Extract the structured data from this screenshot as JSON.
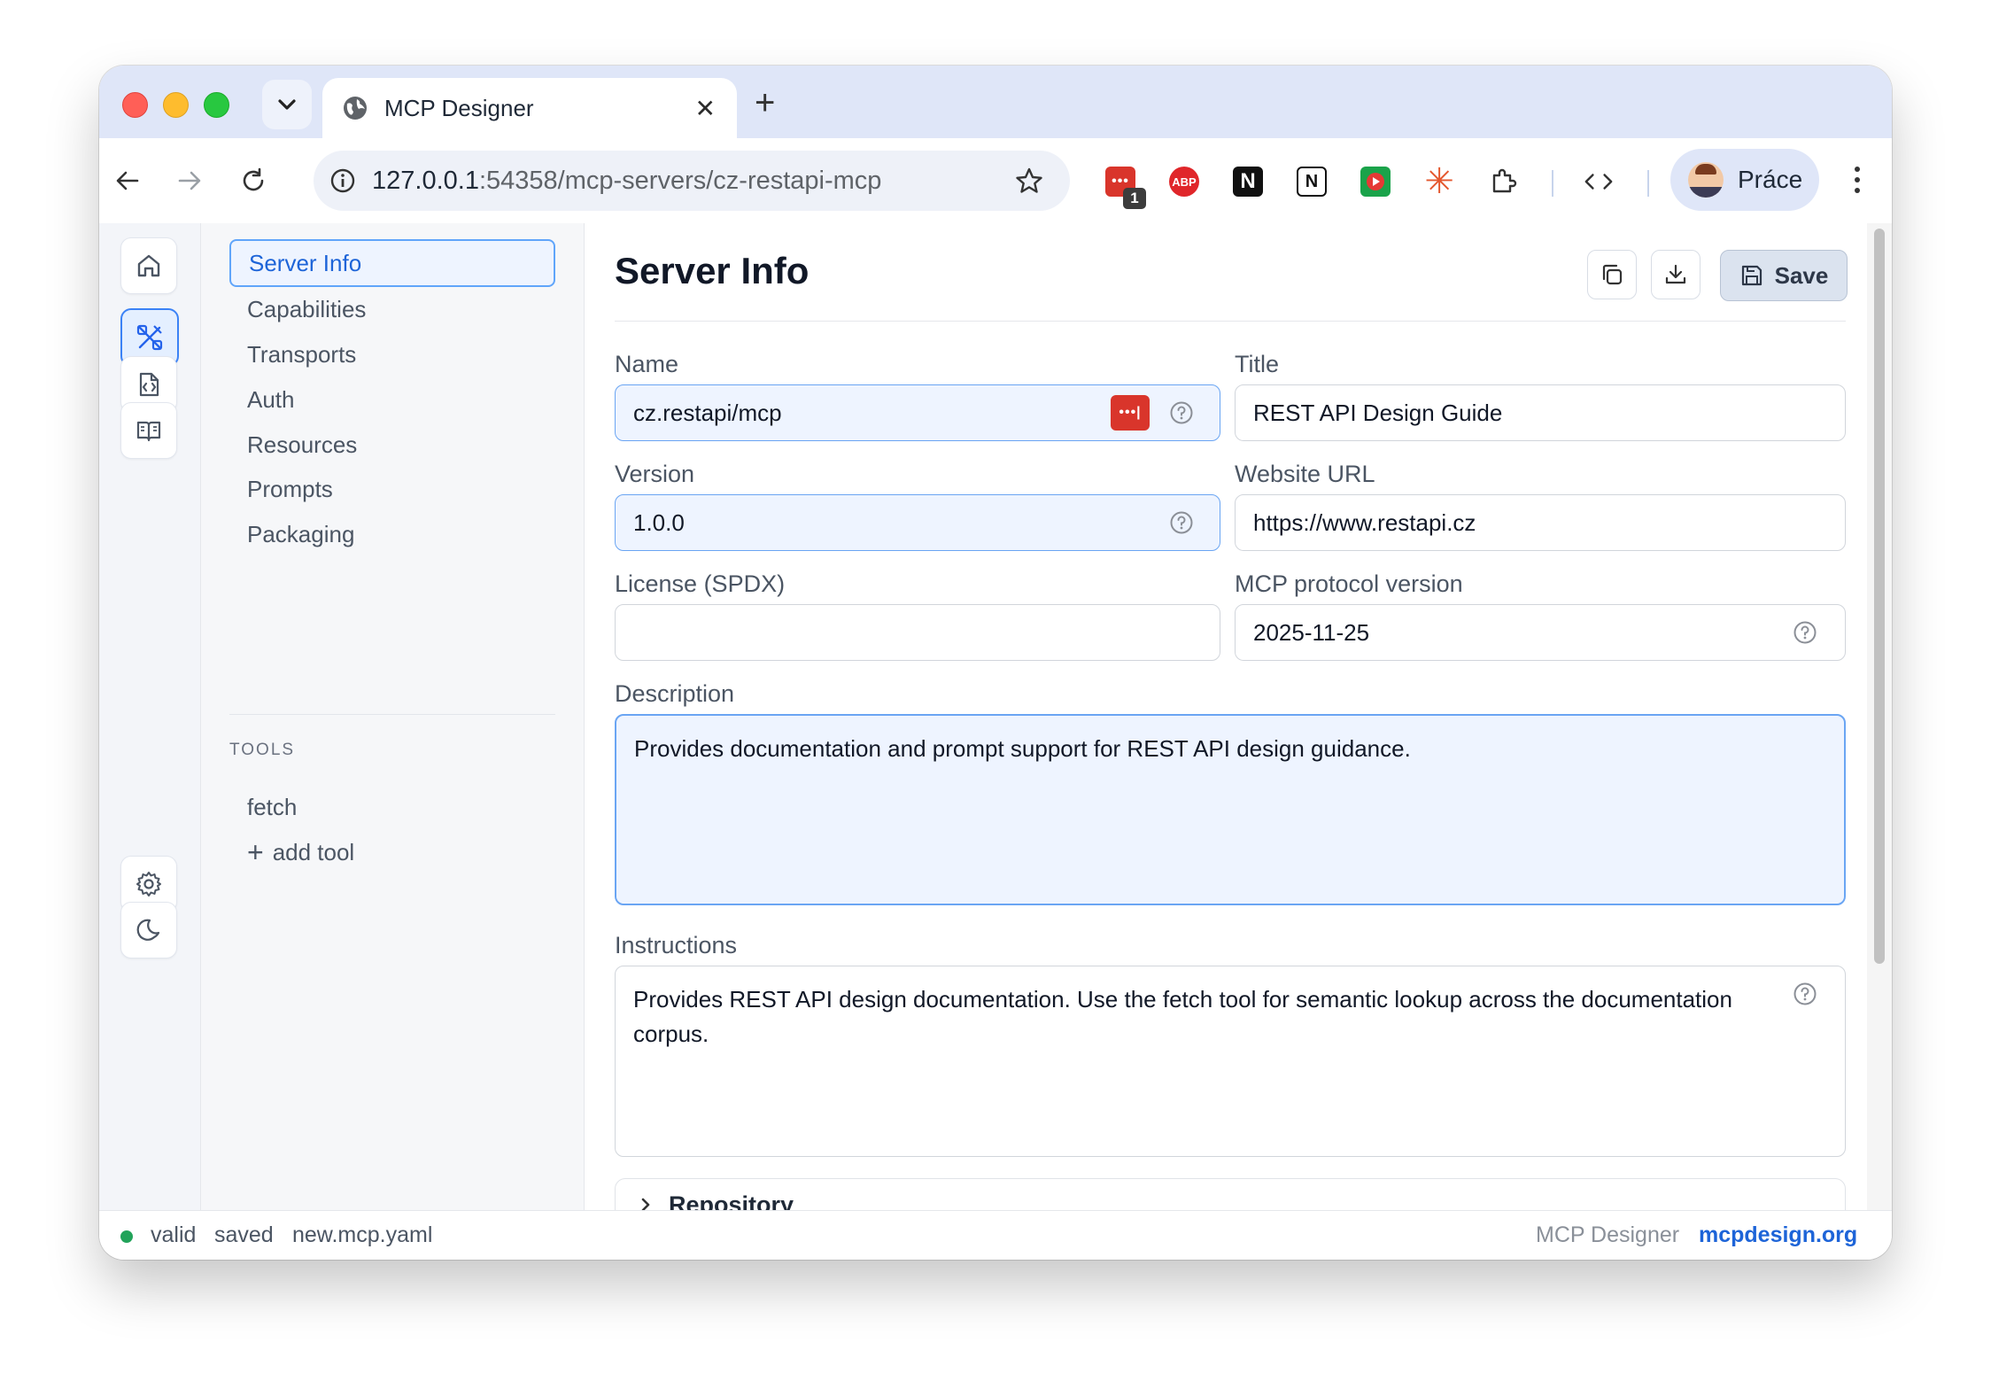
{
  "browser": {
    "tab_title": "MCP Designer",
    "url_host": "127.0.0.1",
    "url_path": ":54358/mcp-servers/cz-restapi-mcp",
    "profile_name": "Práce",
    "extension_badge": "1",
    "abp_label": "ABP",
    "notion_label": "N"
  },
  "sidebar": {
    "items": [
      {
        "label": "Server Info"
      },
      {
        "label": "Capabilities"
      },
      {
        "label": "Transports"
      },
      {
        "label": "Auth"
      },
      {
        "label": "Resources"
      },
      {
        "label": "Prompts"
      },
      {
        "label": "Packaging"
      }
    ],
    "tools_heading": "TOOLS",
    "tools": [
      {
        "label": "fetch"
      }
    ],
    "add_tool_label": "add tool"
  },
  "main": {
    "title": "Server Info",
    "save_label": "Save",
    "fields": {
      "name": {
        "label": "Name",
        "value": "cz.restapi/mcp"
      },
      "title": {
        "label": "Title",
        "value": "REST API Design Guide"
      },
      "version": {
        "label": "Version",
        "value": "1.0.0"
      },
      "website": {
        "label": "Website URL",
        "value": "https://www.restapi.cz"
      },
      "license": {
        "label": "License (SPDX)",
        "value": ""
      },
      "protocol": {
        "label": "MCP protocol version",
        "value": "2025-11-25"
      },
      "description": {
        "label": "Description",
        "value": "Provides documentation and prompt support for REST API design guidance."
      },
      "instructions": {
        "label": "Instructions",
        "value": "Provides REST API design documentation. Use the fetch tool for semantic lookup across the documentation corpus."
      }
    },
    "repository_label": "Repository"
  },
  "status": {
    "valid": "valid",
    "saved": "saved",
    "file": "new.mcp.yaml",
    "app_name": "MCP Designer",
    "site": "mcpdesign.org"
  },
  "colors": {
    "accent": "#1d64d8",
    "status_ok": "#22a35a",
    "password_badge": "#d9352b"
  }
}
